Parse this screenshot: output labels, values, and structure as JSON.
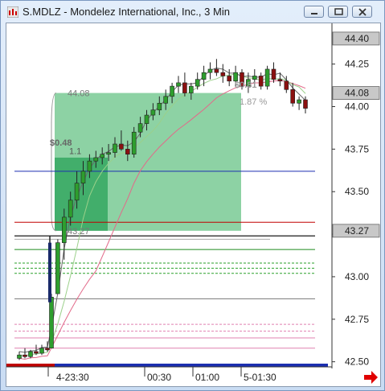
{
  "window": {
    "title": "S.MDLZ - Mondelez International, Inc., 3 Min"
  },
  "window_buttons": {
    "minimize": "minimize-icon",
    "maximize": "maximize-icon",
    "close": "close-icon"
  },
  "colors": {
    "up": "#2e9e2e",
    "down": "#8b1010",
    "box_large": "#5cbf7e",
    "box_small": "#2fa55c",
    "ma_fast": "#6a6a6a",
    "ma_slow": "#e26a8a",
    "ma_mid": "#9bd08a",
    "red_line": "#c00000",
    "blue_line": "#1c2fb0",
    "black_line": "#000000",
    "green_line": "#1d8a1d",
    "dashed_green": "#2aa12a",
    "pink_line": "#e080b0",
    "price_flag": "#c8c8c8",
    "nav_arrow": "#e00000"
  },
  "chart_data": {
    "type": "candlestick",
    "symbol": "S.MDLZ",
    "timeframe": "3 Min",
    "ylim": [
      42.47,
      44.48
    ],
    "y_ticks": [
      "44.25",
      "44.00",
      "43.75",
      "43.50",
      "43.25",
      "43.00",
      "42.75",
      "42.50"
    ],
    "x_ticks": [
      "4-23:30",
      "00:30",
      "01:00",
      "5-01:30"
    ],
    "top_price_flag": "44.40",
    "current_price_flag": "44.08",
    "level_price_flag": "43.27",
    "annotations": {
      "box_top_value": "44.08",
      "box_bottom_value": "43.27",
      "small_gain": "$0.48",
      "small_gain_pct": "1.1",
      "large_gain": "$0.81",
      "large_gain_pct": "1.87 %"
    },
    "candles": [
      [
        42.52,
        42.56,
        42.51,
        42.54
      ],
      [
        42.54,
        42.58,
        42.52,
        42.53
      ],
      [
        42.53,
        42.57,
        42.52,
        42.56
      ],
      [
        42.56,
        42.6,
        42.54,
        42.55
      ],
      [
        42.55,
        42.6,
        42.54,
        42.58
      ],
      [
        42.58,
        42.62,
        42.56,
        42.57
      ],
      [
        42.58,
        42.9,
        42.85,
        42.88
      ],
      [
        42.9,
        43.22,
        42.95,
        43.2
      ],
      [
        43.2,
        43.4,
        43.1,
        43.35
      ],
      [
        43.35,
        43.5,
        43.3,
        43.45
      ],
      [
        43.45,
        43.62,
        43.4,
        43.55
      ],
      [
        43.55,
        43.68,
        43.48,
        43.62
      ],
      [
        43.62,
        43.72,
        43.58,
        43.68
      ],
      [
        43.68,
        43.74,
        43.64,
        43.7
      ],
      [
        43.7,
        43.76,
        43.66,
        43.72
      ],
      [
        43.72,
        43.78,
        43.68,
        43.73
      ],
      [
        43.73,
        43.82,
        43.7,
        43.78
      ],
      [
        43.78,
        43.86,
        43.74,
        43.75
      ],
      [
        43.75,
        43.8,
        43.68,
        43.72
      ],
      [
        43.72,
        43.88,
        43.7,
        43.85
      ],
      [
        43.85,
        43.94,
        43.82,
        43.9
      ],
      [
        43.9,
        43.98,
        43.86,
        43.95
      ],
      [
        43.95,
        44.02,
        43.92,
        43.98
      ],
      [
        43.98,
        44.06,
        43.95,
        44.02
      ],
      [
        44.02,
        44.1,
        43.98,
        44.06
      ],
      [
        44.06,
        44.14,
        44.02,
        44.12
      ],
      [
        44.12,
        44.18,
        44.08,
        44.14
      ],
      [
        44.14,
        44.2,
        44.06,
        44.08
      ],
      [
        44.08,
        44.14,
        44.04,
        44.12
      ],
      [
        44.12,
        44.2,
        44.1,
        44.16
      ],
      [
        44.16,
        44.24,
        44.12,
        44.2
      ],
      [
        44.2,
        44.26,
        44.16,
        44.22
      ],
      [
        44.22,
        44.28,
        44.18,
        44.2
      ],
      [
        44.2,
        44.25,
        44.14,
        44.18
      ],
      [
        44.18,
        44.22,
        44.12,
        44.15
      ],
      [
        44.15,
        44.24,
        44.12,
        44.2
      ],
      [
        44.2,
        44.22,
        44.1,
        44.12
      ],
      [
        44.12,
        44.2,
        44.08,
        44.16
      ],
      [
        44.16,
        44.22,
        44.12,
        44.18
      ],
      [
        44.18,
        44.2,
        44.1,
        44.12
      ],
      [
        44.12,
        44.24,
        44.1,
        44.22
      ],
      [
        44.22,
        44.26,
        44.14,
        44.16
      ],
      [
        44.16,
        44.2,
        44.12,
        44.15
      ],
      [
        44.15,
        44.18,
        44.08,
        44.1
      ],
      [
        44.1,
        44.14,
        44.0,
        44.02
      ],
      [
        44.02,
        44.06,
        43.98,
        44.04
      ],
      [
        44.04,
        44.06,
        43.96,
        43.99
      ]
    ],
    "levels": {
      "blue": 43.62,
      "red": 43.32,
      "black_a": 43.24,
      "black_b": 42.87,
      "green_solid": 43.16,
      "dashed_green": [
        43.08,
        43.05,
        43.02
      ],
      "pink": [
        42.72,
        42.68,
        42.64,
        42.58
      ],
      "bottom": 42.49
    }
  }
}
